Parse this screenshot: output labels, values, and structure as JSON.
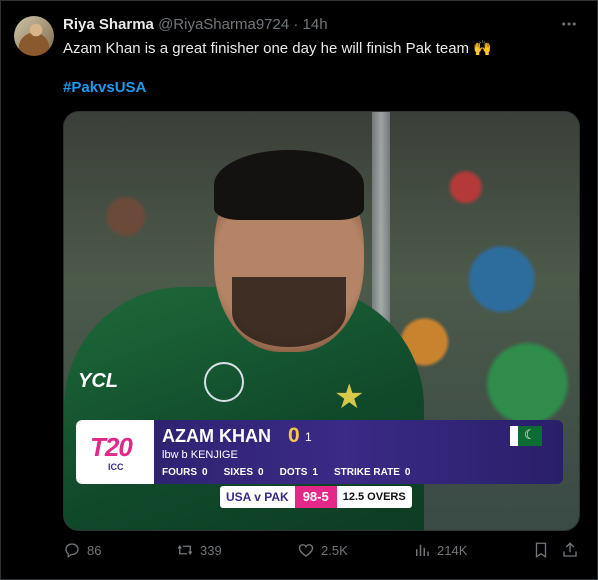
{
  "author": {
    "name": "Riya Sharma",
    "handle": "@RiyaSharma9724",
    "separator": "·",
    "time": "14h"
  },
  "tweet": {
    "text": "Azam Khan is a great finisher one day he will finish Pak team 🙌",
    "hashtag": "#PakvsUSA"
  },
  "more_icon": "more-horizontal-icon",
  "media": {
    "jersey_logo": "YCL",
    "scorecard": {
      "tournament_logo": "T20",
      "tournament_sub": "ICC",
      "batter_name": "AZAM KHAN",
      "runs": "0",
      "balls": "1",
      "dismissal": "lbw  b KENJIGE",
      "stats": [
        {
          "label": "FOURS",
          "value": "0"
        },
        {
          "label": "SIXES",
          "value": "0"
        },
        {
          "label": "DOTS",
          "value": "1"
        },
        {
          "label": "STRIKE RATE",
          "value": "0"
        }
      ],
      "flag": "pakistan-flag",
      "teams": "USA v PAK",
      "score": "98-5",
      "overs": "12.5 OVERS"
    },
    "colors": {
      "scorebar": "#3b2a86",
      "accent_pink": "#e4288a",
      "runs_yellow": "#f6c84a"
    }
  },
  "actions": {
    "replies": "86",
    "reposts": "339",
    "likes": "2.5K",
    "views": "214K"
  },
  "colors": {
    "link": "#1d9bf0",
    "muted": "#71767b",
    "background": "#000000"
  }
}
